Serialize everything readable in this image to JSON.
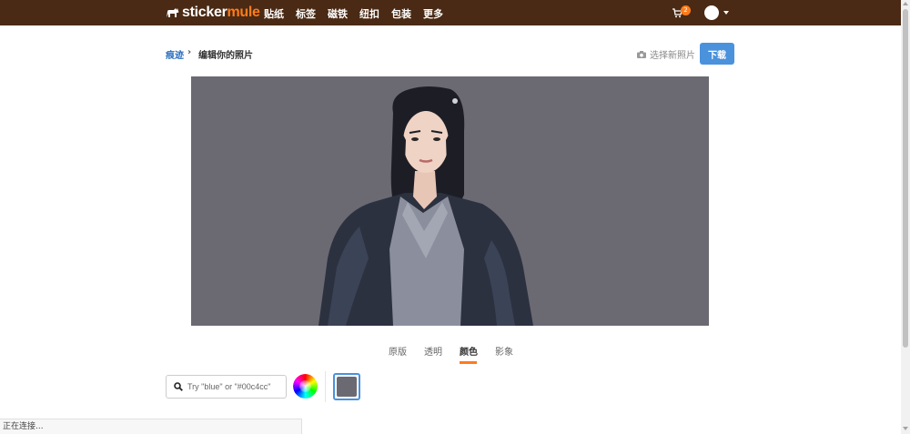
{
  "brand": {
    "logo_main": "sticker",
    "logo_accent": "mule",
    "accent_color": "#ff7b1a",
    "nav_bg": "#4a2a14"
  },
  "nav": {
    "items": [
      {
        "label": "贴纸"
      },
      {
        "label": "标签"
      },
      {
        "label": "磁铁"
      },
      {
        "label": "纽扣"
      },
      {
        "label": "包装"
      },
      {
        "label": "更多"
      }
    ],
    "cart_count": "2"
  },
  "breadcrumb": {
    "link": "痕迹",
    "current": "编辑你的照片"
  },
  "actions": {
    "choose_photo": "选择新照片",
    "download": "下载"
  },
  "preview": {
    "background_color": "#6b6a73"
  },
  "tabs": [
    {
      "label": "原版",
      "active": false
    },
    {
      "label": "透明",
      "active": false
    },
    {
      "label": "颜色",
      "active": true
    },
    {
      "label": "影象",
      "active": false
    }
  ],
  "color_picker": {
    "placeholder": "Try \"blue\" or \"#00c4cc\"",
    "value": "",
    "selected_color": "#6b6a73"
  },
  "status": {
    "text": "正在连接..."
  }
}
